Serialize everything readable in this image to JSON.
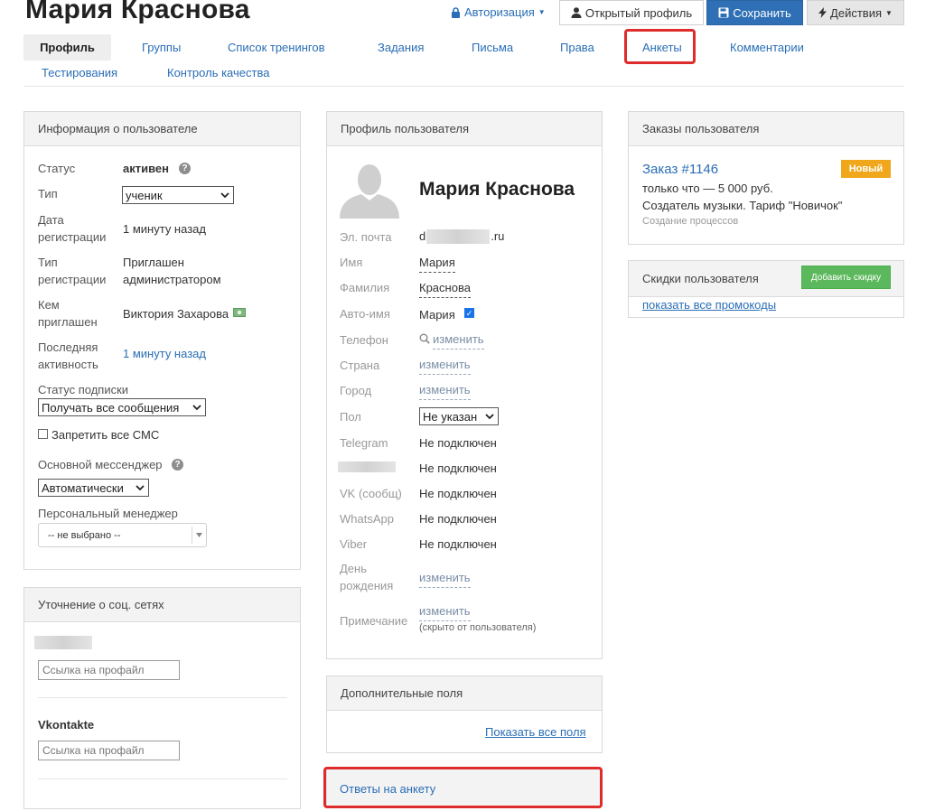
{
  "header": {
    "title": "Мария Краснова",
    "auth_label": "Авторизация",
    "open_profile_label": "Открытый профиль",
    "save_label": "Сохранить",
    "actions_label": "Действия"
  },
  "tabs": {
    "profile": "Профиль",
    "groups": "Группы",
    "trainings": "Список тренингов",
    "tasks": "Задания",
    "letters": "Письма",
    "rights": "Права",
    "surveys": "Анкеты",
    "comments": "Комментарии",
    "testing": "Тестирования",
    "quality": "Контроль качества"
  },
  "user_info": {
    "title": "Информация о пользователе",
    "status_label": "Статус",
    "status_value": "активен",
    "type_label": "Тип",
    "type_value": "ученик",
    "reg_date_label_1": "Дата",
    "reg_date_label_2": "регистрации",
    "reg_date_value": "1 минуту назад",
    "reg_type_label_1": "Тип",
    "reg_type_label_2": "регистрации",
    "reg_type_value_1": "Приглашен",
    "reg_type_value_2": "администратором",
    "invited_by_label_1": "Кем",
    "invited_by_label_2": "приглашен",
    "invited_by_value": "Виктория Захарова",
    "last_activity_label_1": "Последняя",
    "last_activity_label_2": "активность",
    "last_activity_value": "1 минуту назад",
    "subscription_label": "Статус подписки",
    "subscription_value": "Получать все сообщения",
    "forbid_sms_label": "Запретить все СМС",
    "messenger_label": "Основной мессенджер",
    "messenger_value": "Автоматически",
    "manager_label": "Персональный менеджер",
    "manager_value": "-- не выбрано --"
  },
  "social": {
    "title": "Уточнение о соц. сетях",
    "input_placeholder_1": "Ссылка на профайл",
    "vk_label": "Vkontakte",
    "input_placeholder_2": "Ссылка на профайл"
  },
  "profile": {
    "title": "Профиль пользователя",
    "name": "Мария Краснова",
    "email_label": "Эл. почта",
    "email_prefix": "d",
    "email_suffix": ".ru",
    "first_name_label": "Имя",
    "first_name_value": "Мария",
    "last_name_label": "Фамилия",
    "last_name_value": "Краснова",
    "auto_name_label": "Авто-имя",
    "auto_name_value": "Мария",
    "phone_label": "Телефон",
    "phone_link": "изменить",
    "country_label": "Страна",
    "country_link": "изменить",
    "city_label": "Город",
    "city_link": "изменить",
    "gender_label": "Пол",
    "gender_value": "Не указан",
    "telegram_label": "Telegram",
    "telegram_value": "Не подключен",
    "hidden_value": "Не подключен",
    "vk_label": "VK (сообщ)",
    "vk_value": "Не подключен",
    "whatsapp_label": "WhatsApp",
    "whatsapp_value": "Не подключен",
    "viber_label": "Viber",
    "viber_value": "Не подключен",
    "birthday_label_1": "День",
    "birthday_label_2": "рождения",
    "birthday_link": "изменить",
    "note_label": "Примечание",
    "note_link": "изменить",
    "note_hint": "(скрыто от пользователя)"
  },
  "extra_fields": {
    "title": "Дополнительные поля",
    "show_all": "Показать все поля"
  },
  "survey_answers": {
    "title": "Ответы на анкету"
  },
  "orders": {
    "title": "Заказы пользователя",
    "order_link": "Заказ #1146",
    "badge": "Новый",
    "line1": "только что — 5 000 руб.",
    "line2": "Создатель музыки. Тариф \"Новичок\"",
    "line3": "Создание процессов"
  },
  "discounts": {
    "title": "Скидки пользователя",
    "add_button": "Добавить скидку",
    "show_promos": "показать все промокоды"
  },
  "colors": {
    "accent": "#2a6eb5",
    "save_button": "#2f6fb5",
    "highlight": "#de2c2c",
    "badge": "#f0a71c",
    "green_button": "#5cb85c"
  }
}
